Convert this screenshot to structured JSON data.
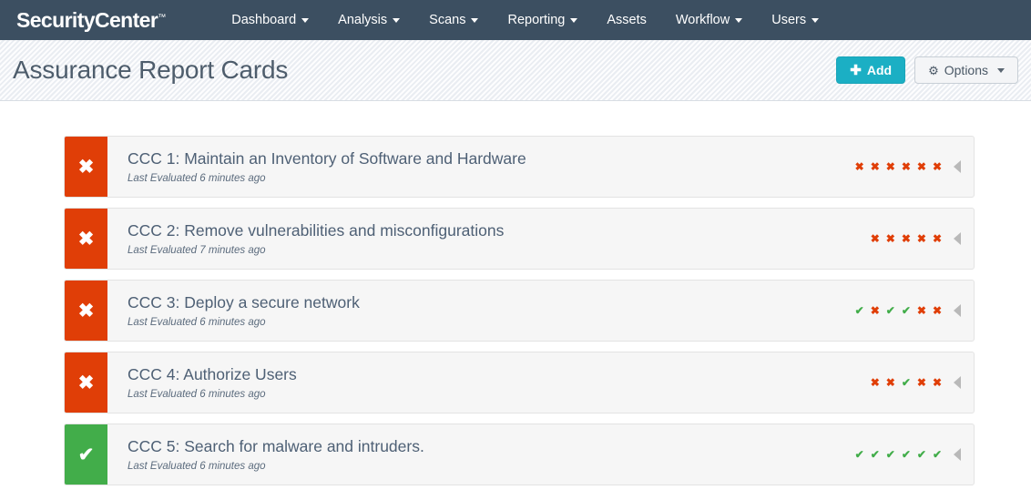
{
  "navbar": {
    "brand": "SecurityCenter",
    "brand_tm": "™",
    "items": [
      {
        "label": "Dashboard",
        "has_caret": true
      },
      {
        "label": "Analysis",
        "has_caret": true
      },
      {
        "label": "Scans",
        "has_caret": true
      },
      {
        "label": "Reporting",
        "has_caret": true
      },
      {
        "label": "Assets",
        "has_caret": false
      },
      {
        "label": "Workflow",
        "has_caret": true
      },
      {
        "label": "Users",
        "has_caret": true
      }
    ]
  },
  "header": {
    "title": "Assurance Report Cards",
    "add_button": {
      "icon": "plus-icon",
      "label": "Add"
    },
    "options_button": {
      "icon": "gear-icon",
      "label": "Options",
      "caret": "chevron-down-icon"
    }
  },
  "colors": {
    "navbar_bg": "#3c4f61",
    "fail": "#e03e07",
    "pass": "#42ad4a",
    "accent": "#1bafc4",
    "title_text": "#4e6075"
  },
  "cards": [
    {
      "status": "fail",
      "status_icon": "x-icon",
      "title": "CCC 1: Maintain an Inventory of Software and Hardware",
      "subtitle": "Last Evaluated 6 minutes ago",
      "marks": [
        "fail",
        "fail",
        "fail",
        "fail",
        "fail",
        "fail"
      ],
      "expander_icon": "triangle-left-icon"
    },
    {
      "status": "fail",
      "status_icon": "x-icon",
      "title": "CCC 2: Remove vulnerabilities and misconfigurations",
      "subtitle": "Last Evaluated 7 minutes ago",
      "marks": [
        "fail",
        "fail",
        "fail",
        "fail",
        "fail"
      ],
      "expander_icon": "triangle-left-icon"
    },
    {
      "status": "fail",
      "status_icon": "x-icon",
      "title": "CCC 3: Deploy a secure network",
      "subtitle": "Last Evaluated 6 minutes ago",
      "marks": [
        "pass",
        "fail",
        "pass",
        "pass",
        "fail",
        "fail"
      ],
      "expander_icon": "triangle-left-icon"
    },
    {
      "status": "fail",
      "status_icon": "x-icon",
      "title": "CCC 4: Authorize Users",
      "subtitle": "Last Evaluated 6 minutes ago",
      "marks": [
        "fail",
        "fail",
        "pass",
        "fail",
        "fail"
      ],
      "expander_icon": "triangle-left-icon"
    },
    {
      "status": "pass",
      "status_icon": "check-icon",
      "title": "CCC 5: Search for malware and intruders.",
      "subtitle": "Last Evaluated 6 minutes ago",
      "marks": [
        "pass",
        "pass",
        "pass",
        "pass",
        "pass",
        "pass"
      ],
      "expander_icon": "triangle-left-icon"
    }
  ],
  "glyphs": {
    "x": "✖",
    "check": "✔",
    "plus": "✚",
    "gear": "⚙"
  }
}
